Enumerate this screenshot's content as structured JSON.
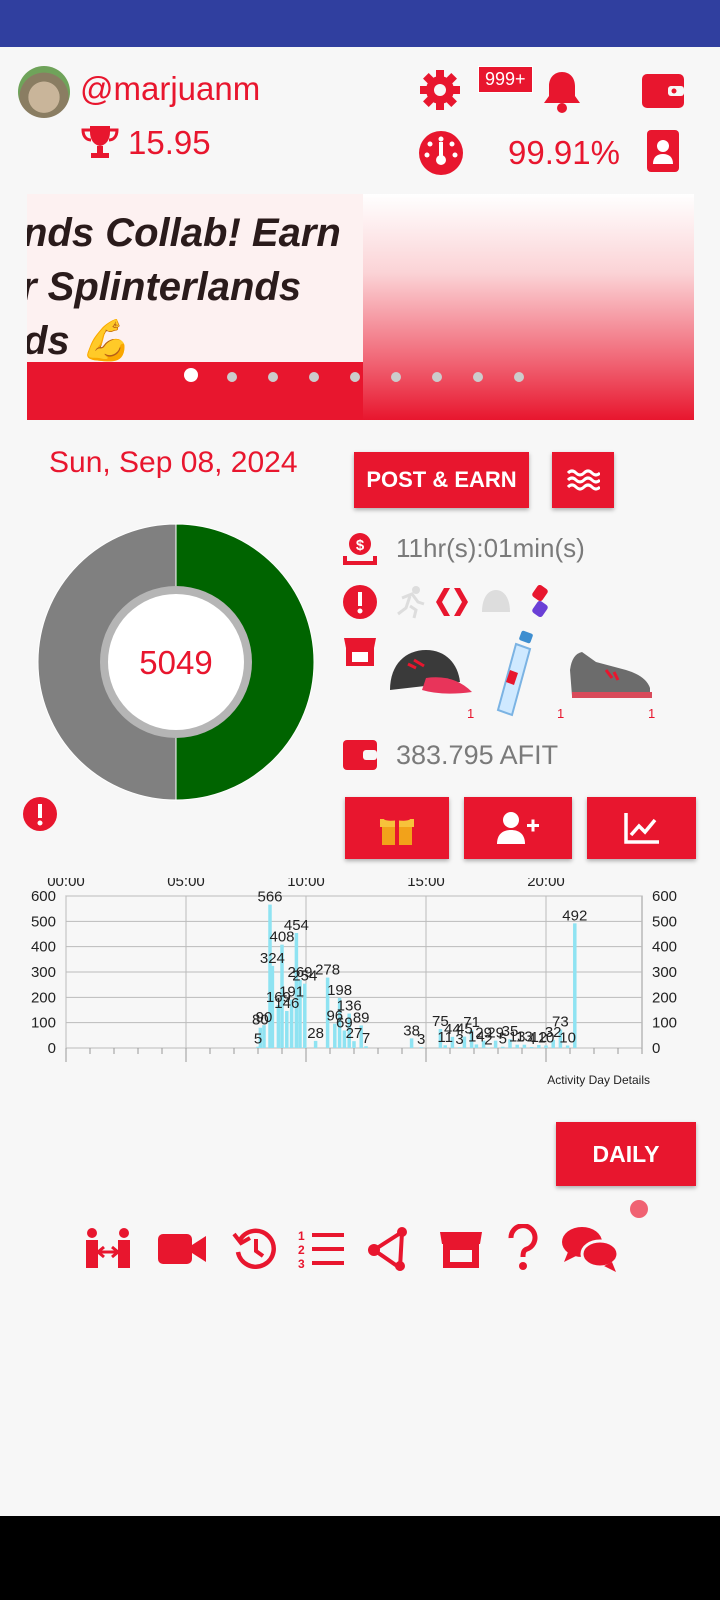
{
  "header": {
    "username": "@marjuanm",
    "trophy_value": "15.95",
    "notification_count": "999+",
    "percentage": "99.91%"
  },
  "banner": {
    "lines": [
      "nds Collab! Earn",
      "r Splinterlands",
      "ds 💪"
    ],
    "slide_count": 9,
    "active_slide": 0
  },
  "summary": {
    "date": "Sun, Sep 08, 2024",
    "post_earn_label": "POST & EARN",
    "steps": "5049",
    "step_progress_fraction": 0.5,
    "timer": "11hr(s):01min(s)",
    "afit_balance": "383.795 AFIT",
    "gear_counts": [
      "1",
      "1",
      "1"
    ]
  },
  "colors": {
    "accent": "#e8162e",
    "progress": "#006400",
    "remaining": "#808080",
    "bars": "#8fe3f2"
  },
  "icons": [
    "gear-icon",
    "bell-icon",
    "wallet-icon",
    "speedometer-icon",
    "id-card-icon",
    "trophy-icon",
    "payout-icon",
    "alert-icon",
    "shop-icon",
    "gift-icon",
    "add-user-icon",
    "chart-icon"
  ],
  "chart_data": {
    "type": "bar",
    "x_tick_labels": [
      "00:00",
      "05:00",
      "10:00",
      "15:00",
      "20:00"
    ],
    "y_tick_labels": [
      "600",
      "500",
      "400",
      "300",
      "200",
      "100",
      "0"
    ],
    "ylim": [
      0,
      600
    ],
    "xlim_hours": [
      0,
      24
    ],
    "annotation": "Activity Day Details",
    "grid": true,
    "bars": [
      {
        "h": 8.0,
        "v": 5,
        "label": "5"
      },
      {
        "h": 8.1,
        "v": 80,
        "label": "80"
      },
      {
        "h": 8.25,
        "v": 90,
        "label": "90"
      },
      {
        "h": 8.5,
        "v": 566,
        "label": "566"
      },
      {
        "h": 8.6,
        "v": 324,
        "label": "324"
      },
      {
        "h": 8.85,
        "v": 169,
        "label": "169"
      },
      {
        "h": 9.0,
        "v": 408,
        "label": "408"
      },
      {
        "h": 9.2,
        "v": 146,
        "label": "146"
      },
      {
        "h": 9.4,
        "v": 191,
        "label": "191"
      },
      {
        "h": 9.6,
        "v": 454,
        "label": "454"
      },
      {
        "h": 9.75,
        "v": 269,
        "label": "269"
      },
      {
        "h": 9.95,
        "v": 254,
        "label": "254"
      },
      {
        "h": 10.4,
        "v": 28,
        "label": "28"
      },
      {
        "h": 10.9,
        "v": 278,
        "label": "278"
      },
      {
        "h": 11.2,
        "v": 96,
        "label": "96"
      },
      {
        "h": 11.4,
        "v": 198,
        "label": "198"
      },
      {
        "h": 11.6,
        "v": 69,
        "label": "69"
      },
      {
        "h": 11.8,
        "v": 136,
        "label": "136"
      },
      {
        "h": 12.0,
        "v": 27,
        "label": "27"
      },
      {
        "h": 12.3,
        "v": 89,
        "label": "89"
      },
      {
        "h": 12.5,
        "v": 7,
        "label": "7"
      },
      {
        "h": 14.4,
        "v": 38,
        "label": "38"
      },
      {
        "h": 14.8,
        "v": 3,
        "label": "3"
      },
      {
        "h": 15.6,
        "v": 75,
        "label": "75"
      },
      {
        "h": 15.8,
        "v": 11,
        "label": "11"
      },
      {
        "h": 16.1,
        "v": 44,
        "label": "44"
      },
      {
        "h": 16.4,
        "v": 3,
        "label": "3"
      },
      {
        "h": 16.6,
        "v": 45,
        "label": "45"
      },
      {
        "h": 16.9,
        "v": 71,
        "label": "71"
      },
      {
        "h": 17.1,
        "v": 14,
        "label": "14"
      },
      {
        "h": 17.4,
        "v": 29,
        "label": "29"
      },
      {
        "h": 17.6,
        "v": 2,
        "label": "2"
      },
      {
        "h": 17.9,
        "v": 29,
        "label": "29"
      },
      {
        "h": 18.2,
        "v": 5,
        "label": "5"
      },
      {
        "h": 18.5,
        "v": 35,
        "label": "35"
      },
      {
        "h": 18.8,
        "v": 13,
        "label": "13"
      },
      {
        "h": 19.1,
        "v": 13,
        "label": "13"
      },
      {
        "h": 19.4,
        "v": 4,
        "label": "4"
      },
      {
        "h": 19.7,
        "v": 12,
        "label": "12"
      },
      {
        "h": 20.0,
        "v": 10,
        "label": "10"
      },
      {
        "h": 20.3,
        "v": 32,
        "label": "32"
      },
      {
        "h": 20.6,
        "v": 73,
        "label": "73"
      },
      {
        "h": 20.9,
        "v": 10,
        "label": "10"
      },
      {
        "h": 21.2,
        "v": 492,
        "label": "492"
      }
    ]
  },
  "footer": {
    "daily_label": "DAILY"
  },
  "bottom_nav": [
    "friends-icon",
    "video-icon",
    "history-icon",
    "ordered-list-icon",
    "share-icon",
    "store-icon",
    "help-icon",
    "chat-icon"
  ]
}
